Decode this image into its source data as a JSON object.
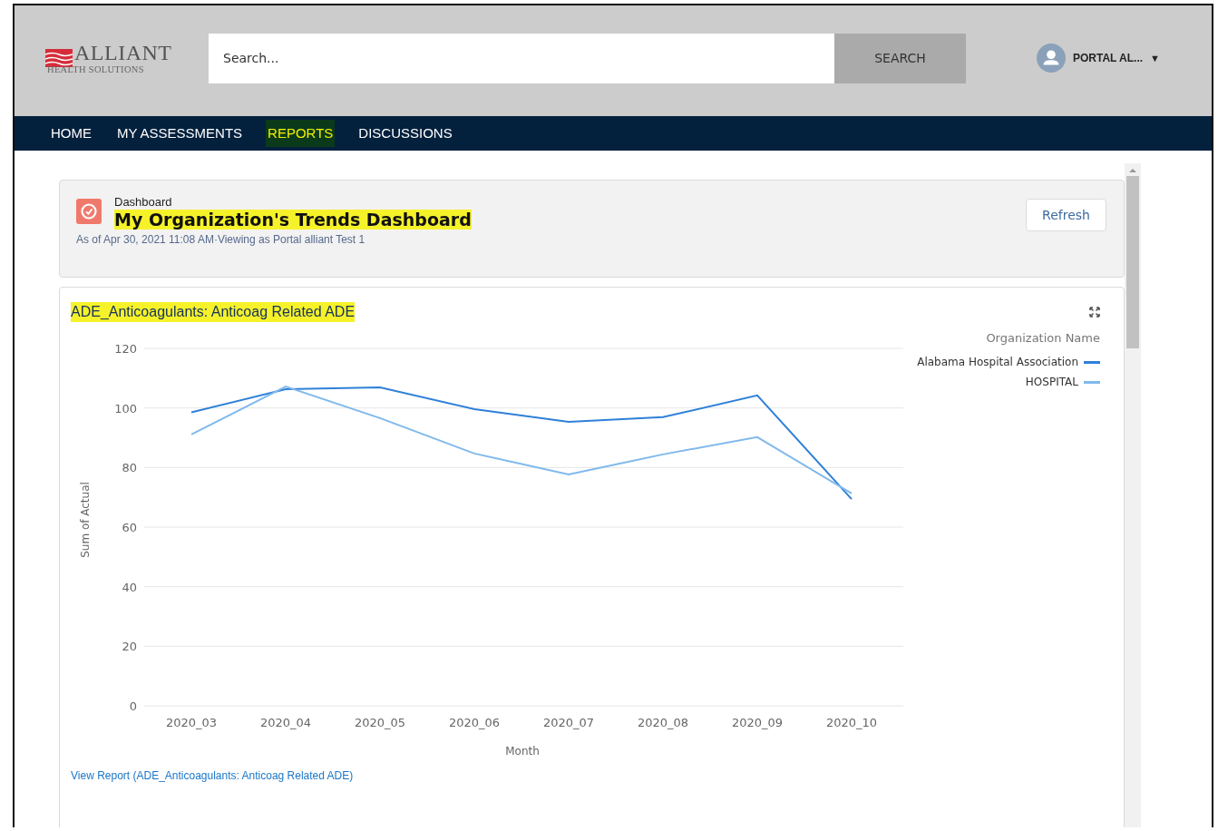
{
  "header": {
    "logo": {
      "name": "ALLIANT",
      "tagline": "HEALTH SOLUTIONS"
    },
    "search": {
      "placeholder": "Search...",
      "button": "SEARCH"
    },
    "user": {
      "name": "PORTAL AL...",
      "caret": "▼"
    }
  },
  "nav": [
    {
      "label": "HOME",
      "highlighted": false
    },
    {
      "label": "MY ASSESSMENTS",
      "highlighted": false
    },
    {
      "label": "REPORTS",
      "highlighted": true
    },
    {
      "label": "DISCUSSIONS",
      "highlighted": false
    }
  ],
  "dashboard": {
    "kind_label": "Dashboard",
    "title": "My Organization's Trends Dashboard",
    "title_highlighted": true,
    "subtitle": "As of Apr 30, 2021 11:08 AM·Viewing as Portal alliant Test 1",
    "refresh": "Refresh"
  },
  "widget": {
    "title": "ADE_Anticoagulants: Anticoag Related ADE",
    "title_highlighted": true,
    "legend_title": "Organization Name",
    "link": "View Report (ADE_Anticoagulants: Anticoag Related ADE)",
    "chart_data": {
      "type": "line",
      "xlabel": "Month",
      "ylabel": "Sum of Actual",
      "categories": [
        "2020_03",
        "2020_04",
        "2020_05",
        "2020_06",
        "2020_07",
        "2020_08",
        "2020_09",
        "2020_10"
      ],
      "series": [
        {
          "name": "Alabama Hospital Association",
          "color": "#2f80d8",
          "values": [
            98.5,
            106.3,
            106.9,
            99.6,
            95.3,
            96.9,
            104.2,
            69.4
          ]
        },
        {
          "name": "HOSPITAL",
          "color": "#80b9ec",
          "values": [
            91.1,
            107.2,
            96.6,
            84.7,
            77.7,
            84.4,
            90.2,
            71.3
          ]
        }
      ],
      "grid": true,
      "ylim": [
        0,
        120
      ],
      "yticks": [
        0,
        20,
        40,
        60,
        80,
        100,
        120
      ]
    }
  }
}
